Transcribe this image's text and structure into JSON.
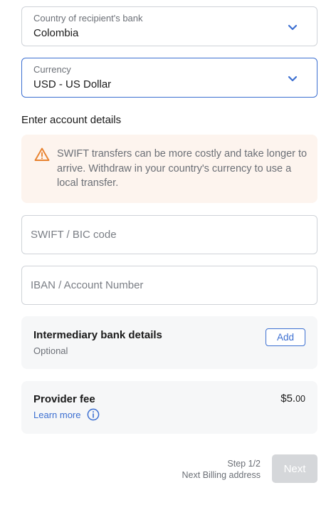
{
  "country_select": {
    "label": "Country of recipient's bank",
    "value": "Colombia",
    "icon": "chevron-down-icon"
  },
  "currency_select": {
    "label": "Currency",
    "value": "USD - US Dollar",
    "icon": "chevron-down-icon"
  },
  "account_section": {
    "title": "Enter account details"
  },
  "warning": {
    "icon": "warning-triangle-icon",
    "text": "SWIFT transfers can be more costly and take longer to arrive. Withdraw in your country's currency to use a local transfer."
  },
  "swift_input": {
    "placeholder": "SWIFT / BIC code",
    "value": ""
  },
  "iban_input": {
    "placeholder": "IBAN / Account Number",
    "value": ""
  },
  "intermediary": {
    "title": "Intermediary bank details",
    "subtitle": "Optional",
    "add_label": "Add"
  },
  "provider_fee": {
    "title": "Provider fee",
    "amount_main": "$5.",
    "amount_cents": "00",
    "learn_more": "Learn more",
    "info_icon": "info-circle-icon"
  },
  "footer": {
    "step": "Step 1/2",
    "next_step": "Next Billing address",
    "next_label": "Next"
  },
  "colors": {
    "accent": "#3c6fd1",
    "warning": "#e8822f",
    "warning_bg": "#fdf4ee",
    "card_bg": "#f6f7f8",
    "disabled_button": "#d5d7da"
  }
}
